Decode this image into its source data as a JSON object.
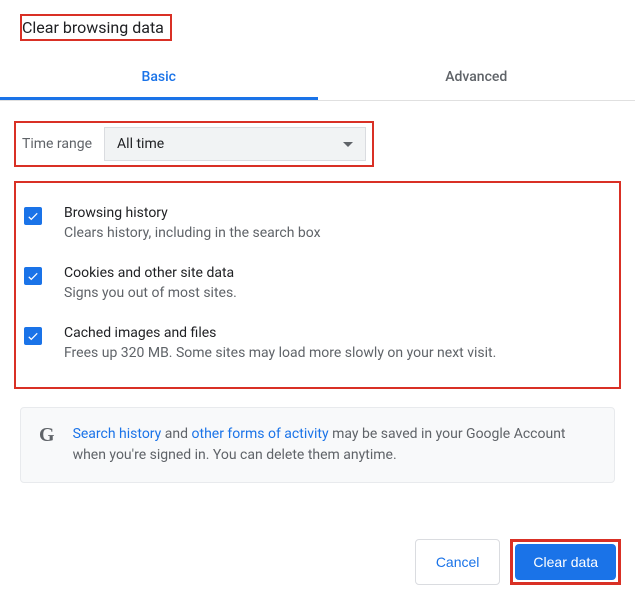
{
  "title": "Clear browsing data",
  "tabs": {
    "basic": "Basic",
    "advanced": "Advanced"
  },
  "timeRange": {
    "label": "Time range",
    "value": "All time"
  },
  "options": [
    {
      "title": "Browsing history",
      "desc": "Clears history, including in the search box",
      "checked": true
    },
    {
      "title": "Cookies and other site data",
      "desc": "Signs you out of most sites.",
      "checked": true
    },
    {
      "title": "Cached images and files",
      "desc": "Frees up 320 MB. Some sites may load more slowly on your next visit.",
      "checked": true
    }
  ],
  "info": {
    "link1": "Search history",
    "mid1": " and ",
    "link2": "other forms of activity",
    "rest": " may be saved in your Google Account when you're signed in. You can delete them anytime."
  },
  "buttons": {
    "cancel": "Cancel",
    "clear": "Clear data"
  }
}
